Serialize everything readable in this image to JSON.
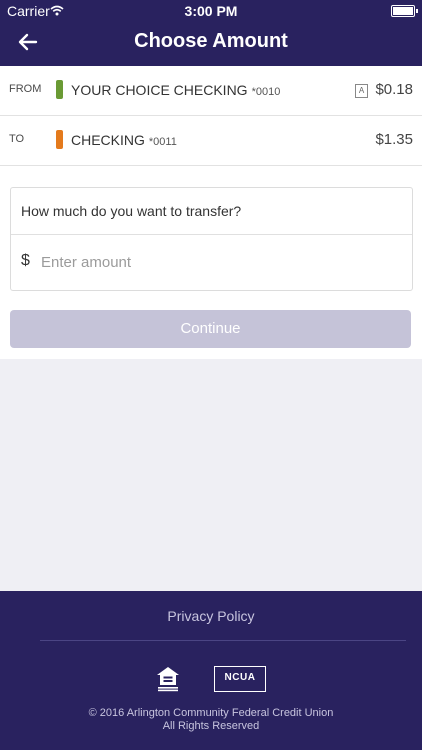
{
  "status_bar": {
    "carrier": "Carrier",
    "time": "3:00 PM"
  },
  "header": {
    "title": "Choose Amount"
  },
  "from_account": {
    "label": "FROM",
    "name": "YOUR CHOICE CHECKING",
    "number": "*0010",
    "badge": "A",
    "balance": "$0.18",
    "color": "#6a9a34"
  },
  "to_account": {
    "label": "TO",
    "name": "CHECKING",
    "number": "*0011",
    "balance": "$1.35",
    "color": "#e47a1c"
  },
  "amount_card": {
    "prompt": "How much do you want to transfer?",
    "currency": "$",
    "placeholder": "Enter amount"
  },
  "continue_button": {
    "label": "Continue"
  },
  "footer": {
    "privacy": "Privacy Policy",
    "ncua": "NCUA",
    "copyright": "© 2016 Arlington Community Federal Credit Union",
    "rights": "All Rights Reserved"
  },
  "colors": {
    "brand": "#29225f",
    "disabled_button": "#c5c3d8",
    "background": "#efeff4"
  }
}
